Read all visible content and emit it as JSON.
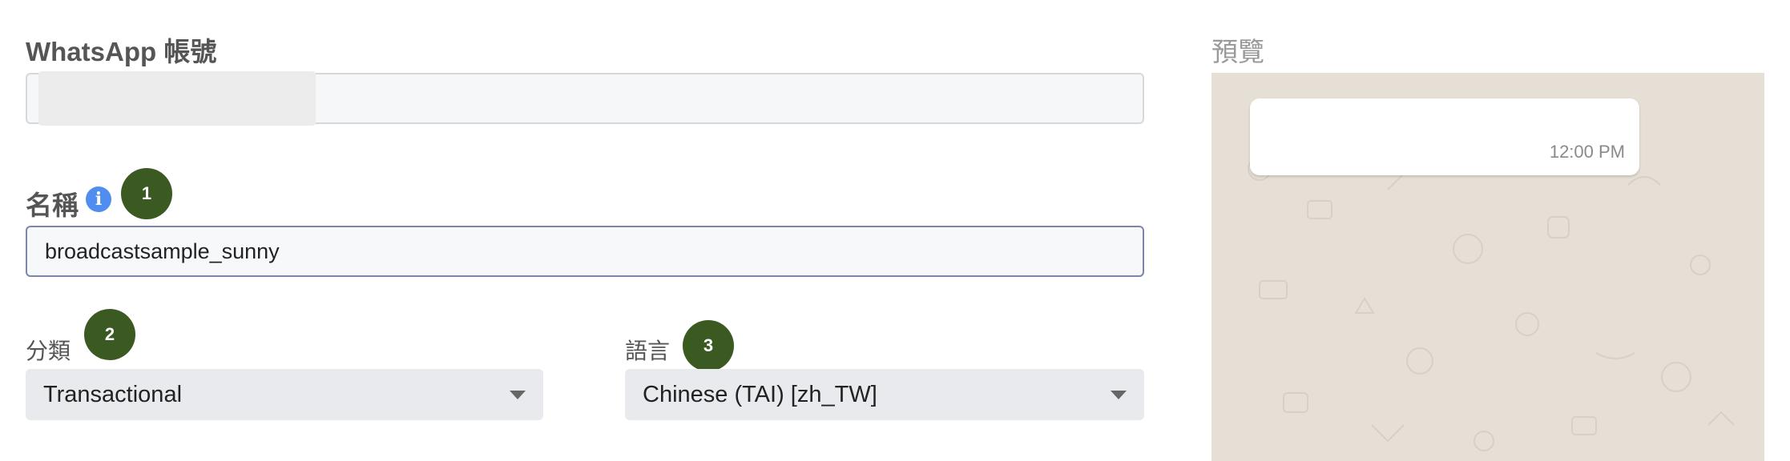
{
  "form": {
    "account_label": "WhatsApp 帳號",
    "name_label": "名稱",
    "name_value": "broadcastsample_sunny",
    "category_label": "分類",
    "category_value": "Transactional",
    "language_label": "語言",
    "language_value": "Chinese (TAI) [zh_TW]"
  },
  "badges": [
    "1",
    "2",
    "3"
  ],
  "preview": {
    "label": "預覽",
    "time": "12:00 PM"
  },
  "icons": {
    "info": "info-icon",
    "caret": "chevron-down-icon"
  },
  "colors": {
    "badge": "#3a5a22",
    "info": "#4f8ef0",
    "preview_bg": "#e6dfd6"
  }
}
